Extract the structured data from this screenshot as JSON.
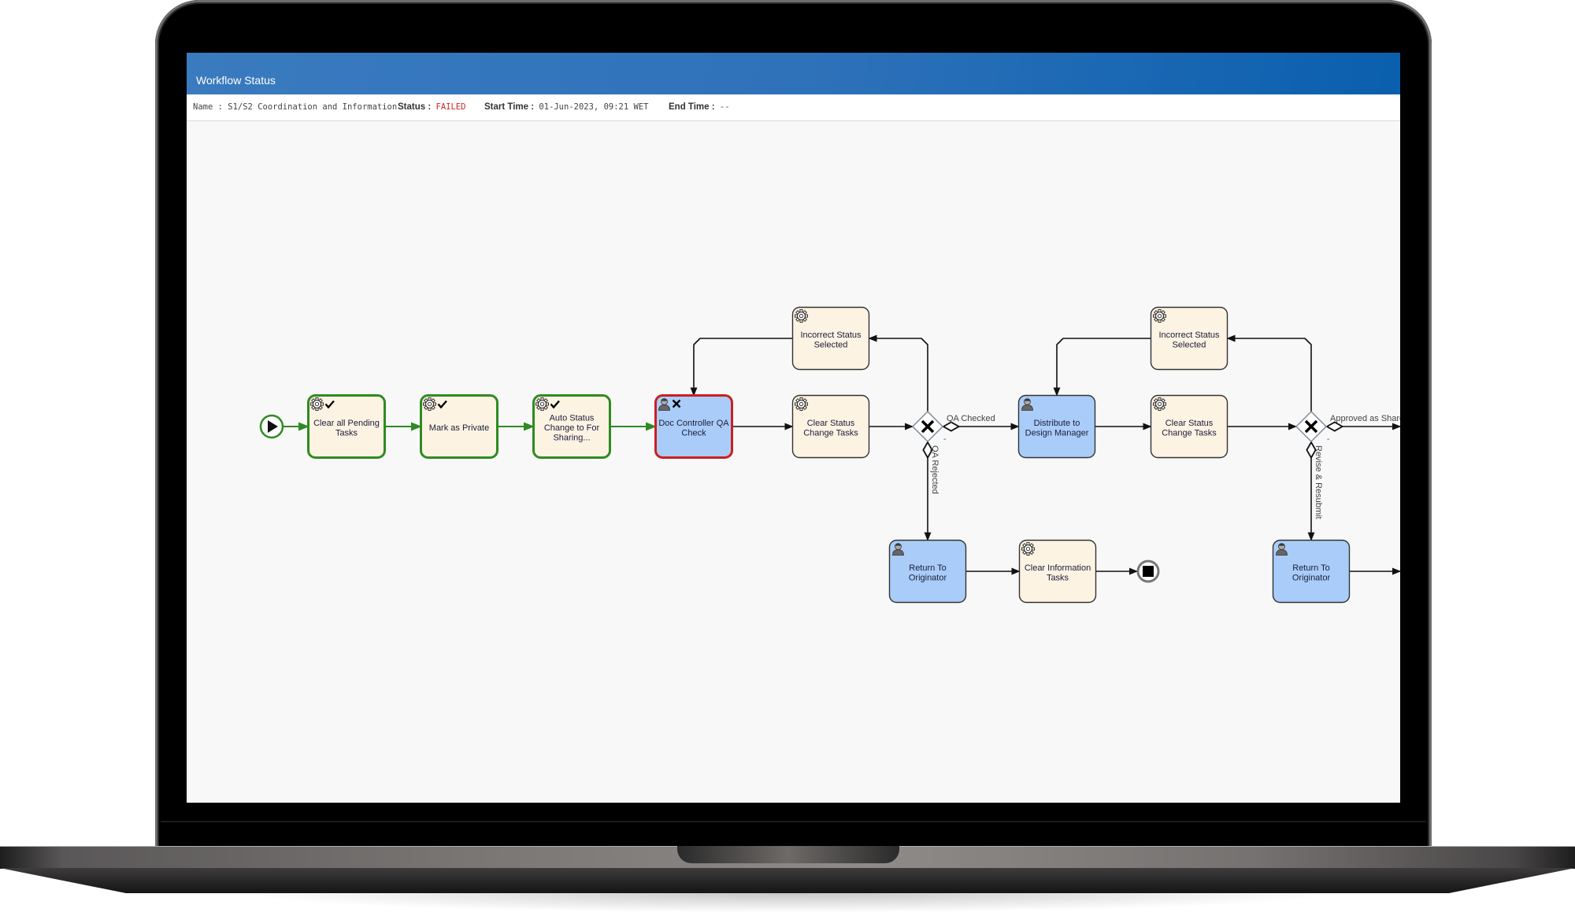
{
  "header": {
    "title": "Workflow Status"
  },
  "info": {
    "name_label": "Name :",
    "name_value": "S1/S2 Coordination and Information",
    "status_label": "Status :",
    "status_value": "FAILED",
    "start_label": "Start Time :",
    "start_value": "01-Jun-2023, 09:21 WET",
    "end_label": "End Time :",
    "end_value": "--"
  },
  "colors": {
    "header_blue": "#2f72ba",
    "status_failed": "#c62828",
    "completed_border": "#2e8b22",
    "failed_border": "#cc1f1f",
    "service_fill": "#fdf3e3",
    "user_fill": "#a9cdf8",
    "default_border": "#333333"
  },
  "diagram": {
    "start_event": {
      "id": "start",
      "state": "completed"
    },
    "end_event": {
      "id": "end"
    },
    "tasks": [
      {
        "id": "t1",
        "type": "service",
        "label": [
          "Clear all Pending",
          "Tasks"
        ],
        "state": "completed"
      },
      {
        "id": "t2",
        "type": "service",
        "label": [
          "Mark as Private"
        ],
        "state": "completed"
      },
      {
        "id": "t3",
        "type": "service",
        "label": [
          "Auto Status",
          "Change to For",
          "Sharing..."
        ],
        "state": "completed"
      },
      {
        "id": "t4",
        "type": "user",
        "label": [
          "Doc Controller QA",
          "Check"
        ],
        "state": "failed"
      },
      {
        "id": "t5",
        "type": "service",
        "label": [
          "Clear Status",
          "Change Tasks"
        ],
        "state": "pending"
      },
      {
        "id": "t6",
        "type": "service",
        "label": [
          "Incorrect Status",
          "Selected"
        ],
        "state": "pending"
      },
      {
        "id": "t7",
        "type": "user",
        "label": [
          "Return To",
          "Originator"
        ],
        "state": "pending"
      },
      {
        "id": "t8",
        "type": "service",
        "label": [
          "Clear Information",
          "Tasks"
        ],
        "state": "pending"
      },
      {
        "id": "t9",
        "type": "user",
        "label": [
          "Distribute to",
          "Design Manager"
        ],
        "state": "pending"
      },
      {
        "id": "t10",
        "type": "service",
        "label": [
          "Clear Status",
          "Change Tasks"
        ],
        "state": "pending"
      },
      {
        "id": "t11",
        "type": "service",
        "label": [
          "Incorrect Status",
          "Selected"
        ],
        "state": "pending"
      },
      {
        "id": "t12",
        "type": "user",
        "label": [
          "Return To",
          "Originator"
        ],
        "state": "pending"
      }
    ],
    "gateways": [
      {
        "id": "g1",
        "type": "exclusive"
      },
      {
        "id": "g2",
        "type": "exclusive"
      }
    ],
    "flow_labels": {
      "g1_right": "QA Checked",
      "g1_down": "QA Rejected",
      "g2_right": "Approved as Shared",
      "g2_down": "Revise & Resubmit"
    }
  }
}
